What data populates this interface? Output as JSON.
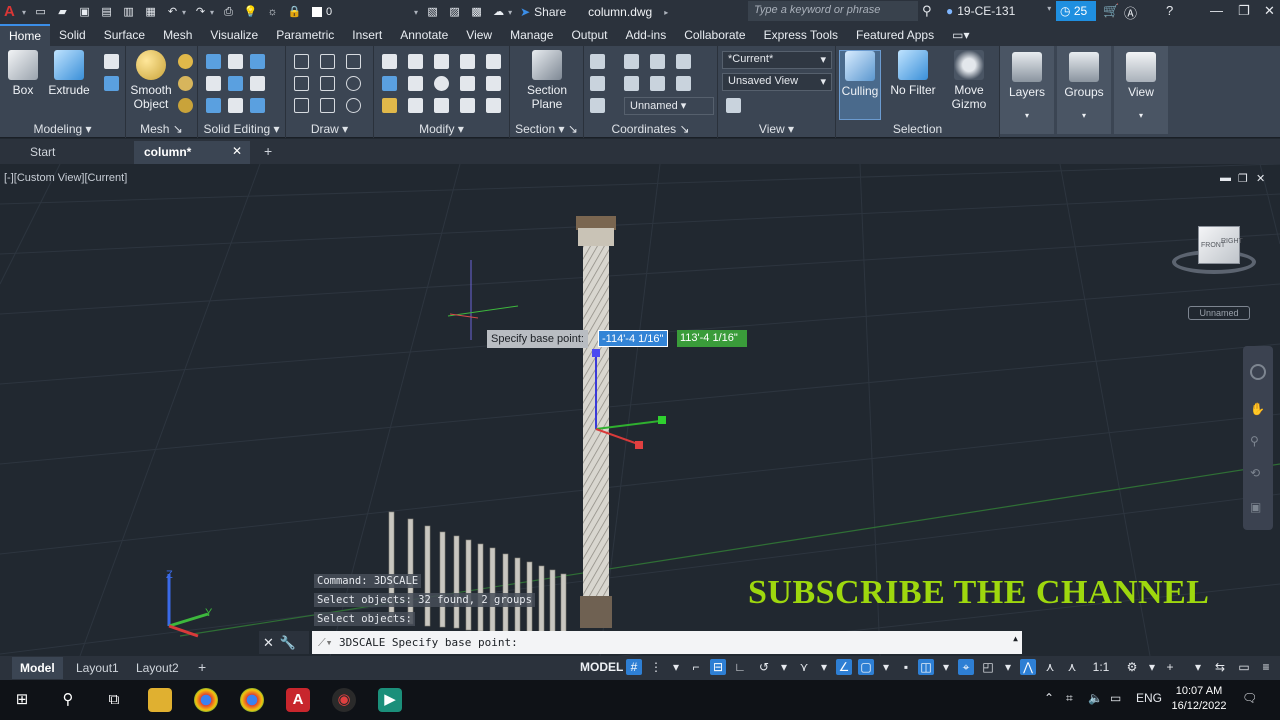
{
  "titlebar": {
    "layer_value": "0",
    "share_label": "Share",
    "document_title": "column.dwg",
    "search_placeholder": "Type a keyword or phrase",
    "user_name": "19-CE-131",
    "badge_count": "25"
  },
  "ribbon_tabs": [
    "Home",
    "Solid",
    "Surface",
    "Mesh",
    "Visualize",
    "Parametric",
    "Insert",
    "Annotate",
    "View",
    "Manage",
    "Output",
    "Add-ins",
    "Collaborate",
    "Express Tools",
    "Featured Apps"
  ],
  "ribbon": {
    "box_label": "Box",
    "extrude_label": "Extrude",
    "smooth_object_label": "Smooth Object",
    "section_plane_label": "Section Plane",
    "current_view": "*Current*",
    "unsaved_view": "Unsaved View",
    "unnamed_ucs": "Unnamed",
    "culling_label": "Culling",
    "no_filter_label": "No Filter",
    "move_gizmo_label": "Move Gizmo",
    "layers_label": "Layers",
    "groups_label": "Groups",
    "view_label": "View",
    "panels": {
      "modeling": "Modeling",
      "mesh": "Mesh",
      "solid_editing": "Solid Editing",
      "draw": "Draw",
      "modify": "Modify",
      "section": "Section",
      "coordinates": "Coordinates",
      "view": "View",
      "selection": "Selection"
    }
  },
  "file_tabs": {
    "start": "Start",
    "active": "column*"
  },
  "viewport": {
    "label": "[-][Custom View][Current]",
    "viewcube_tag": "Unnamed",
    "viewcube_faces": {
      "front": "FRONT",
      "right": "RIGHT"
    },
    "tooltip": "Specify base point:",
    "coord_x": "-114'-4 1/16\"",
    "coord_y": "113'-4 1/16\"",
    "subscribe_text": "SUBSCRIBE THE CHANNEL",
    "ucs_axes": {
      "x": "X",
      "y": "Y",
      "z": "Z"
    }
  },
  "command_history": [
    "Command: 3DSCALE",
    "Select objects: 32 found, 2 groups",
    "Select objects:"
  ],
  "command_line": {
    "text": "3DSCALE Specify base point:"
  },
  "statusbar": {
    "layouts": [
      "Model",
      "Layout1",
      "Layout2"
    ],
    "model_button": "MODEL",
    "scale": "1:1"
  },
  "taskbar": {
    "language": "ENG",
    "time": "10:07 AM",
    "date": "16/12/2022"
  }
}
